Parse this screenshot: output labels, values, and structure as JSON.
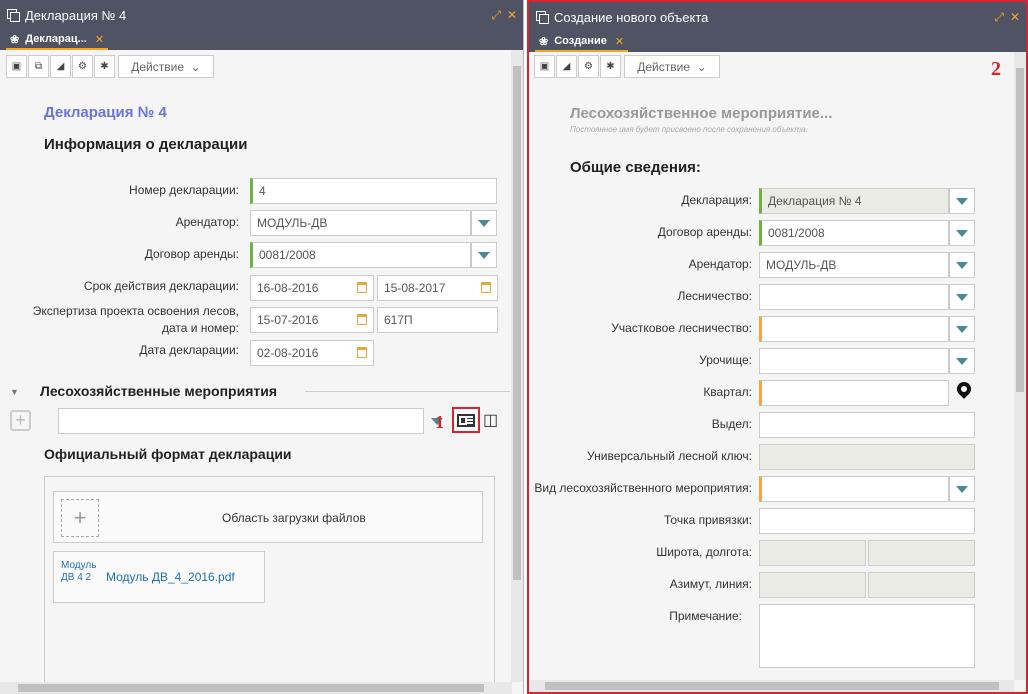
{
  "left": {
    "window_title": "Декларация № 4",
    "tab": "Декларац...",
    "toolbar": {
      "action": "Действие"
    },
    "doc_title": "Декларация № 4",
    "info_header": "Информация о декларации",
    "fields": {
      "number_label": "Номер декларации:",
      "number_value": "4",
      "tenant_label": "Арендатор:",
      "tenant_value": "МОДУЛЬ-ДВ",
      "lease_label": "Договор аренды:",
      "lease_value": "0081/2008",
      "period_label": "Срок действия декларации:",
      "period_from": "16-08-2016",
      "period_to": "15-08-2017",
      "expertise_label_1": "Экспертиза проекта освоения лесов,",
      "expertise_label_2": "дата и номер:",
      "expertise_date": "15-07-2016",
      "expertise_number": "617П",
      "date_label": "Дата декларации:",
      "date_value": "02-08-2016"
    },
    "events_header": "Лесохозяйственные мероприятия",
    "marker_1": "1",
    "format_header": "Официальный формат декларации",
    "upload_label": "Область загрузки файлов",
    "file_name": "Модуль ДВ_4_2016.pdf",
    "file_thumb_alt": "Модуль ДВ 4 2"
  },
  "right": {
    "window_title": "Создание нового объекта",
    "tab": "Создание",
    "toolbar": {
      "action": "Действие"
    },
    "marker_2": "2",
    "obj_title": "Лесохозяйственное мероприятие...",
    "obj_hint": "Постоянное имя будет присвоено после сохранения объекта.",
    "section": "Общие сведения:",
    "fields": {
      "decl_label": "Декларация:",
      "decl_value": "Декларация № 4",
      "lease_label": "Договор аренды:",
      "lease_value": "0081/2008",
      "tenant_label": "Арендатор:",
      "tenant_value": "МОДУЛЬ-ДВ",
      "forestry_label": "Лесничество:",
      "district_label": "Участковое лесничество:",
      "tract_label": "Урочище:",
      "quarter_label": "Квартал:",
      "section_label": "Выдел:",
      "key_label": "Универсальный лесной ключ:",
      "type_label": "Вид лесохозяйственного мероприятия:",
      "point_label": "Точка привязки:",
      "latlon_label": "Широта, долгота:",
      "azimuth_label": "Азимут, линия:",
      "note_label": "Примечание:"
    }
  }
}
